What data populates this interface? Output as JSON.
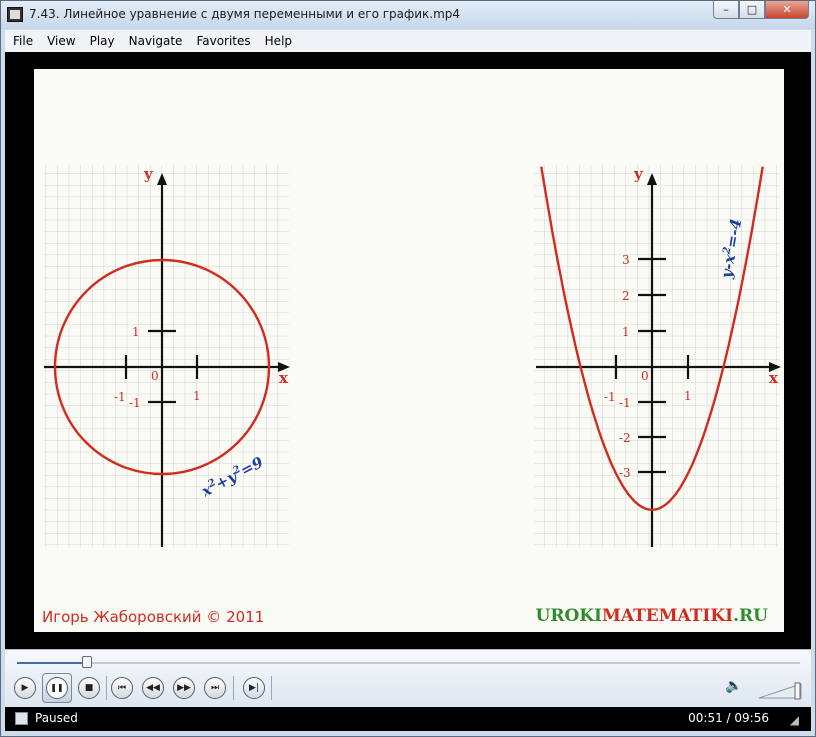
{
  "window": {
    "title": "7.43. Линейное уравнение с двумя переменными и его график.mp4",
    "min_symbol": "–",
    "max_symbol": "□",
    "close_symbol": "✕"
  },
  "menu": [
    "File",
    "View",
    "Play",
    "Navigate",
    "Favorites",
    "Help"
  ],
  "video_frame": {
    "left_graph": {
      "y_label": "y",
      "x_label": "x",
      "origin_label": "0",
      "tick_labels": {
        "x_neg1": "-1",
        "x_pos1": "1",
        "y_pos1": "1",
        "y_neg1": "-1"
      },
      "equation_main": "x",
      "equation_sup1": "2",
      "equation_plus": "+y",
      "equation_sup2": "2",
      "equation_rest": "=9",
      "curve_color": "#d22b1f"
    },
    "right_graph": {
      "y_label": "y",
      "x_label": "x",
      "origin_label": "0",
      "tick_labels": {
        "x_neg1": "-1",
        "x_pos1": "1",
        "y_pos1": "1",
        "y_pos2": "2",
        "y_pos3": "3",
        "y_neg1": "-1",
        "y_neg2": "-2",
        "y_neg3": "-3"
      },
      "equation_main": "y-x",
      "equation_sup": "2",
      "equation_rest": "=-4",
      "curve_color": "#d22b1f"
    },
    "signature": "Игорь Жаборовский © 2011",
    "site_part1": "UROKI",
    "site_part2": "MATEMATIKI",
    "site_part3": ".RU"
  },
  "player": {
    "progress": 0.0888,
    "buttons": [
      "play-icon",
      "pause-icon",
      "stop-icon",
      "previous-icon",
      "rewind-icon",
      "fast-forward-icon",
      "next-icon",
      "step-icon"
    ],
    "play_glyph": "▶",
    "stop_glyph": "■",
    "prev_glyph": "⏮",
    "rew_glyph": "◀◀",
    "ff_glyph": "▶▶",
    "next_glyph": "⏭",
    "step_glyph": "▶|",
    "pause_glyph": "❚❚",
    "volume_glyph": "🔈"
  },
  "status": {
    "state": "Paused",
    "time": "00:51 / 09:56"
  },
  "colors": {
    "accent": "#d22b1f",
    "equation_blue": "#1c3f9e",
    "site_green": "#2e8b2e"
  }
}
